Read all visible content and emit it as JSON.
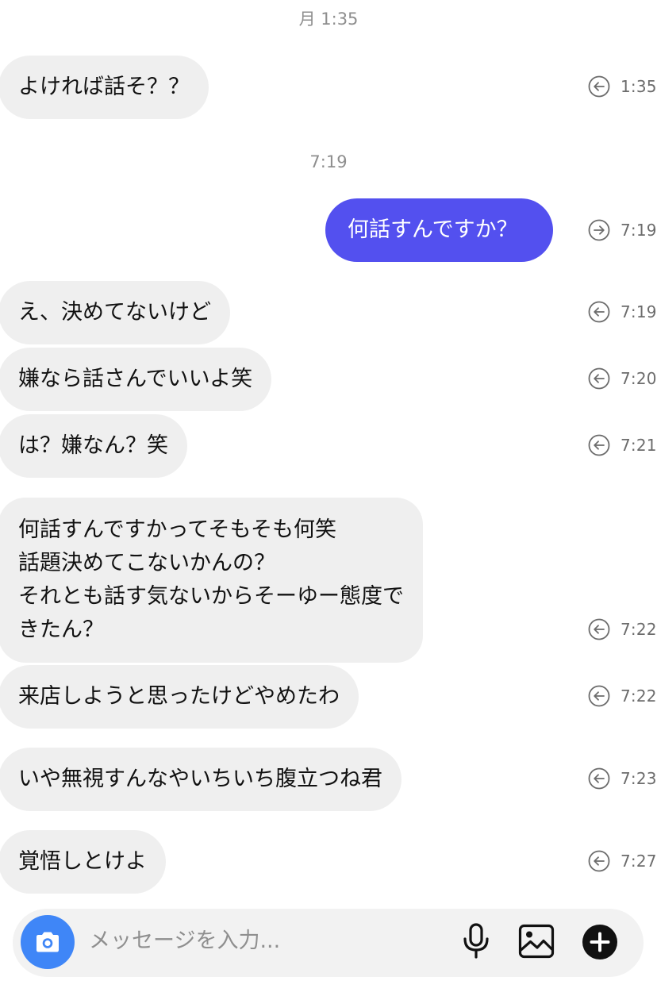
{
  "sections": [
    {
      "label": "月 1:35"
    },
    {
      "label": "7:19"
    }
  ],
  "messages": [
    {
      "direction": "received",
      "lines": [
        "よければ話そ？？"
      ],
      "time": "1:35",
      "status_icon": "received-arrow-icon"
    },
    {
      "direction": "sent",
      "lines": [
        "何話すんですか？"
      ],
      "time": "7:19",
      "status_icon": "sent-arrow-icon"
    },
    {
      "direction": "received",
      "lines": [
        "え、決めてないけど"
      ],
      "time": "7:19",
      "status_icon": "received-arrow-icon"
    },
    {
      "direction": "received",
      "lines": [
        "嫌なら話さんでいいよ笑"
      ],
      "time": "7:20",
      "status_icon": "received-arrow-icon"
    },
    {
      "direction": "received",
      "lines": [
        "は？嫌なん？笑"
      ],
      "time": "7:21",
      "status_icon": "received-arrow-icon"
    },
    {
      "direction": "received",
      "lines": [
        "何話すんですかってそもそも何笑",
        "話題決めてこないかんの？",
        "それとも話す気ないからそーゆー態度で",
        "きたん？"
      ],
      "time": "7:22",
      "status_icon": "received-arrow-icon"
    },
    {
      "direction": "received",
      "lines": [
        "来店しようと思ったけどやめたわ"
      ],
      "time": "7:22",
      "status_icon": "received-arrow-icon"
    },
    {
      "direction": "received",
      "lines": [
        "いや無視すんなやいちいち腹立つね君"
      ],
      "time": "7:23",
      "status_icon": "received-arrow-icon"
    },
    {
      "direction": "received",
      "lines": [
        "覚悟しとけよ"
      ],
      "time": "7:27",
      "status_icon": "received-arrow-icon"
    }
  ],
  "composer": {
    "placeholder": "メッセージを入力...",
    "camera_icon": "camera-icon",
    "mic_icon": "microphone-icon",
    "image_icon": "image-icon",
    "add_icon": "plus-icon"
  },
  "colors": {
    "sent_bubble": "#5350ef",
    "received_bubble": "#efefef",
    "camera_button": "#3f86f7",
    "timestamp": "#6c6c6c"
  }
}
